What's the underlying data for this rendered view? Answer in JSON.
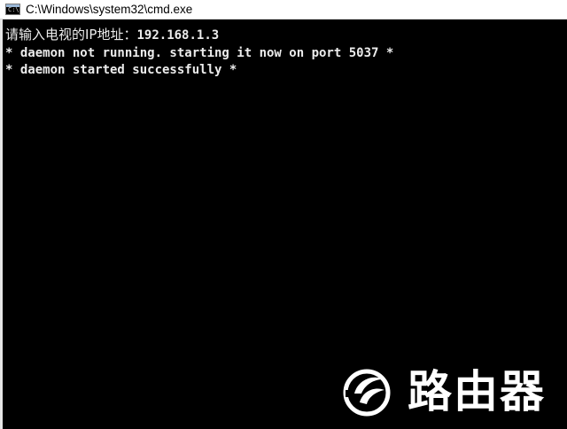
{
  "window": {
    "title": "C:\\Windows\\system32\\cmd.exe",
    "icon": "cmd-window-icon",
    "icon_prompt": "C:\\"
  },
  "console": {
    "lines": [
      {
        "prompt": "请输入电视的IP地址：",
        "value": "192.168.1.3"
      },
      {
        "text": "* daemon not running. starting it now on port 5037 *"
      },
      {
        "text": "* daemon started successfully *"
      }
    ],
    "background": "#000000",
    "foreground": "#ececec"
  },
  "watermark": {
    "logo": "router-brand-logo",
    "text": "路由器"
  }
}
